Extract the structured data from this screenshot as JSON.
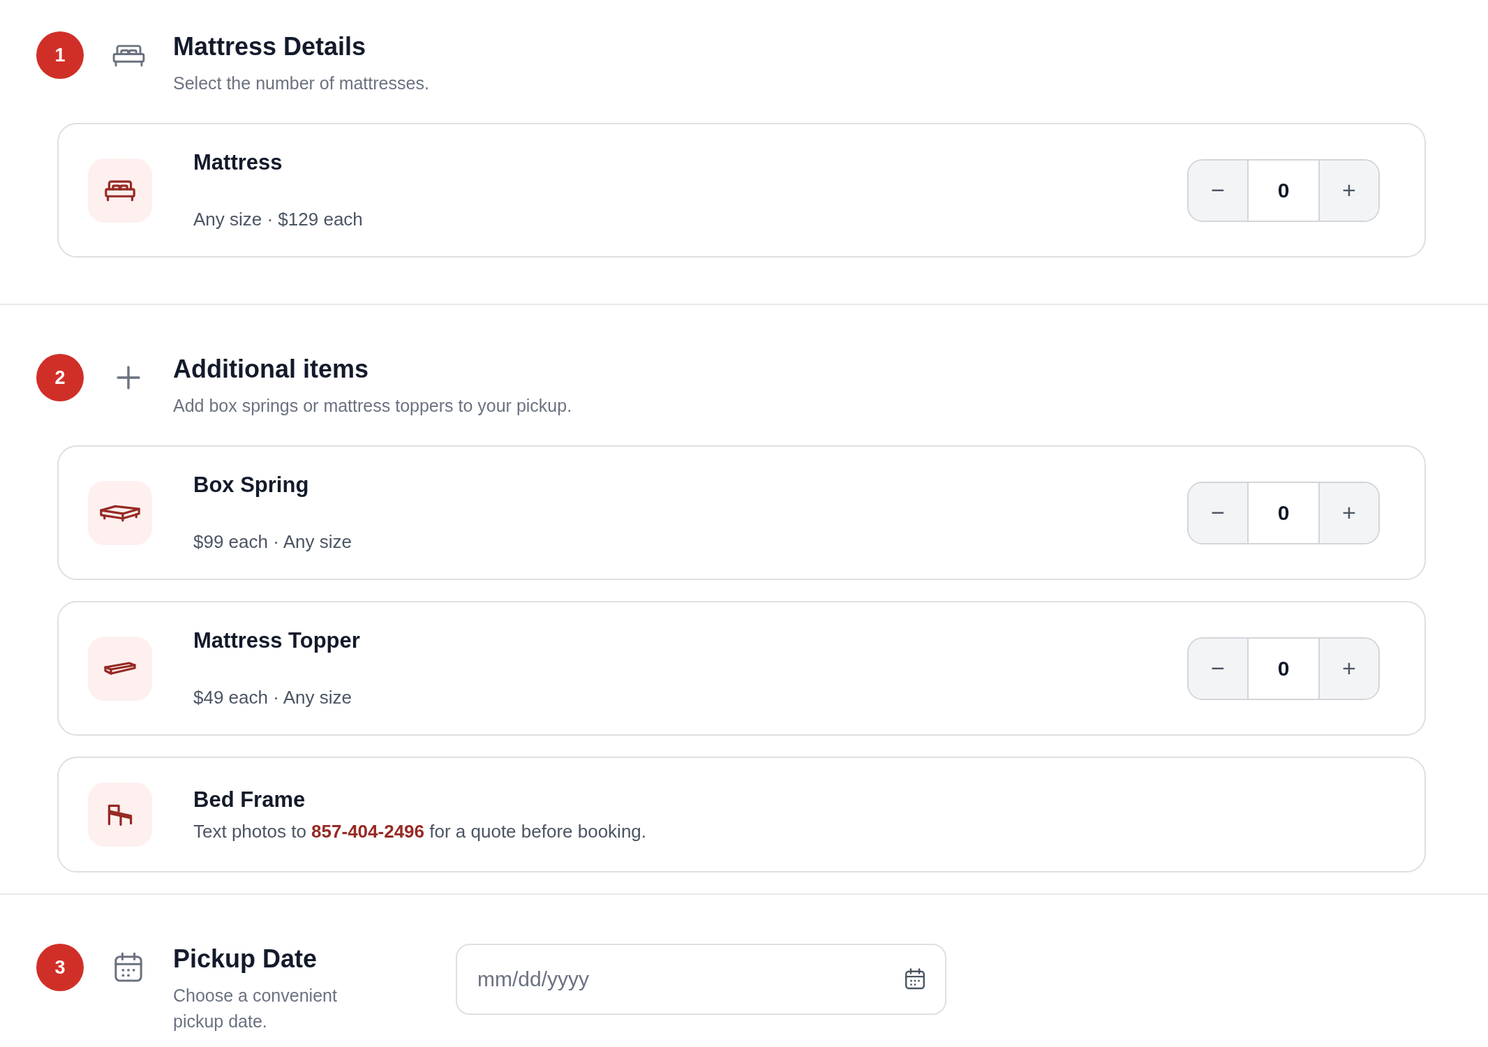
{
  "sections": [
    {
      "kind": "items",
      "step": "1",
      "title": "Mattress Details",
      "subtitle": "Select the number of mattresses.",
      "items": [
        {
          "kind": "counter",
          "name": "Mattress",
          "detail": "Any size · $129 each",
          "decrement": "−",
          "quantity": "0",
          "increment": "+"
        }
      ]
    },
    {
      "kind": "items",
      "step": "2",
      "title": "Additional items",
      "subtitle": "Add box springs or mattress toppers to your pickup.",
      "items": [
        {
          "kind": "counter",
          "name": "Box Spring",
          "detail": "$99 each · Any size",
          "decrement": "−",
          "quantity": "0",
          "increment": "+"
        },
        {
          "kind": "counter",
          "name": "Mattress Topper",
          "detail": "$49 each · Any size",
          "decrement": "−",
          "quantity": "0",
          "increment": "+"
        },
        {
          "kind": "note",
          "name": "Bed Frame",
          "note": "Text photos to **857-404-2496** for a quote before booking."
        }
      ]
    },
    {
      "kind": "date",
      "step": "3",
      "title": "Pickup Date",
      "subtitle": "Choose a convenient pickup date.",
      "date_field": {
        "placeholder": "mm/dd/yyyy"
      }
    }
  ]
}
